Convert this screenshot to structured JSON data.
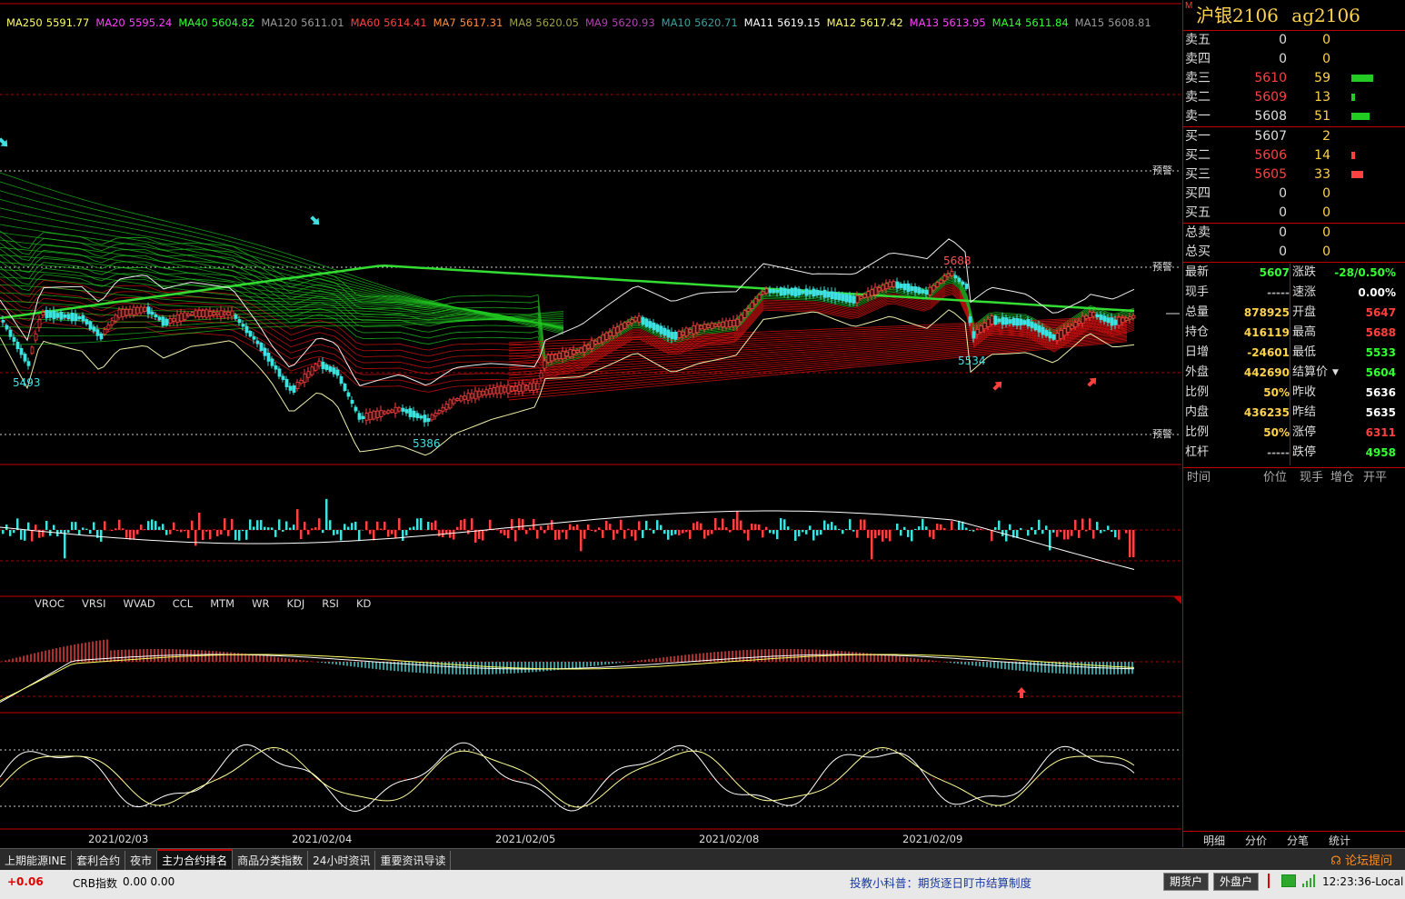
{
  "ma_legend": [
    {
      "label": "MA250",
      "value": "5591.77",
      "color": "#ffff66"
    },
    {
      "label": "MA20",
      "value": "5595.24",
      "color": "#ff40ff"
    },
    {
      "label": "MA40",
      "value": "5604.82",
      "color": "#33ff33"
    },
    {
      "label": "MA120",
      "value": "5611.01",
      "color": "#9a9a9a"
    },
    {
      "label": "MA60",
      "value": "5614.41",
      "color": "#ff4040"
    },
    {
      "label": "MA7",
      "value": "5617.31",
      "color": "#ff8c40"
    },
    {
      "label": "MA8",
      "value": "5620.05",
      "color": "#a0a040"
    },
    {
      "label": "MA9",
      "value": "5620.93",
      "color": "#b040b0"
    },
    {
      "label": "MA10",
      "value": "5620.71",
      "color": "#3aa0a0"
    },
    {
      "label": "MA11",
      "value": "5619.15",
      "color": "#ffffff"
    },
    {
      "label": "MA12",
      "value": "5617.42",
      "color": "#ffff66"
    },
    {
      "label": "MA13",
      "value": "5613.95",
      "color": "#ff40ff"
    },
    {
      "label": "MA14",
      "value": "5611.84",
      "color": "#33ff33"
    },
    {
      "label": "MA15",
      "value": "5608.81",
      "color": "#9a9a9a"
    }
  ],
  "chart": {
    "alert_label": "预警",
    "price_marks": [
      {
        "text": "5493",
        "color": "#40e0e0"
      },
      {
        "text": "5386",
        "color": "#40e0e0"
      },
      {
        "text": "5688",
        "color": "#ff5050"
      },
      {
        "text": "5534",
        "color": "#40e0e0"
      }
    ],
    "dates": [
      "2021/02/03",
      "2021/02/04",
      "2021/02/05",
      "2021/02/08",
      "2021/02/09"
    ],
    "indicator_tabs": [
      "VROC",
      "VRSI",
      "WVAD",
      "CCL",
      "MTM",
      "WR",
      "KDJ",
      "RSI",
      "KD"
    ]
  },
  "side": {
    "title_flag": "M",
    "title_name": "沪银2106",
    "title_code": "ag2106",
    "sell": [
      {
        "label": "卖五",
        "price": "0",
        "vol": "0",
        "pcolor": "#ddd"
      },
      {
        "label": "卖四",
        "price": "0",
        "vol": "0",
        "pcolor": "#ddd"
      },
      {
        "label": "卖三",
        "price": "5610",
        "vol": "59",
        "pcolor": "#ff4040",
        "bar": 24,
        "bcolor": "#22cc22"
      },
      {
        "label": "卖二",
        "price": "5609",
        "vol": "13",
        "pcolor": "#ff4040",
        "bar": 4,
        "bcolor": "#22cc22"
      },
      {
        "label": "卖一",
        "price": "5608",
        "vol": "51",
        "pcolor": "#ddd",
        "bar": 20,
        "bcolor": "#22cc22"
      }
    ],
    "buy": [
      {
        "label": "买一",
        "price": "5607",
        "vol": "2",
        "pcolor": "#ddd"
      },
      {
        "label": "买二",
        "price": "5606",
        "vol": "14",
        "pcolor": "#ff4040",
        "bar": 4,
        "bcolor": "#ff4040"
      },
      {
        "label": "买三",
        "price": "5605",
        "vol": "33",
        "pcolor": "#ff4040",
        "bar": 13,
        "bcolor": "#ff4040"
      },
      {
        "label": "买四",
        "price": "0",
        "vol": "0",
        "pcolor": "#ddd"
      },
      {
        "label": "买五",
        "price": "0",
        "vol": "0",
        "pcolor": "#ddd"
      }
    ],
    "totals": [
      {
        "label": "总卖",
        "price": "0",
        "vol": "0"
      },
      {
        "label": "总买",
        "price": "0",
        "vol": "0"
      }
    ],
    "quotes": [
      {
        "l1": "最新",
        "v1": "5607",
        "c1": "#33ff33",
        "l2": "涨跌",
        "v2": "-28/0.50%",
        "c2": "#33ff33"
      },
      {
        "l1": "现手",
        "v1": "-----",
        "c1": "#aaa",
        "l2": "速涨",
        "v2": "0.00%",
        "c2": "#fff"
      },
      {
        "l1": "总量",
        "v1": "878925",
        "c1": "#ffd24d",
        "l2": "开盘",
        "v2": "5647",
        "c2": "#ff4040"
      },
      {
        "l1": "持仓",
        "v1": "416119",
        "c1": "#ffd24d",
        "l2": "最高",
        "v2": "5688",
        "c2": "#ff4040"
      },
      {
        "l1": "日增",
        "v1": "-24601",
        "c1": "#ffd24d",
        "l2": "最低",
        "v2": "5533",
        "c2": "#33ff33"
      },
      {
        "l1": "外盘",
        "v1": "442690",
        "c1": "#ffd24d",
        "l2": "结算价",
        "v2": "5604",
        "c2": "#33ff33"
      },
      {
        "l1": "比例",
        "v1": "50%",
        "c1": "#ffd24d",
        "l2": "昨收",
        "v2": "5636",
        "c2": "#fff"
      },
      {
        "l1": "内盘",
        "v1": "436235",
        "c1": "#ffd24d",
        "l2": "昨结",
        "v2": "5635",
        "c2": "#fff"
      },
      {
        "l1": "比例",
        "v1": "50%",
        "c1": "#ffd24d",
        "l2": "涨停",
        "v2": "6311",
        "c2": "#ff4040"
      },
      {
        "l1": "杠杆",
        "v1": "-----",
        "c1": "#aaa",
        "l2": "跌停",
        "v2": "4958",
        "c2": "#33ff33"
      }
    ],
    "tick_header": [
      "时间",
      "价位",
      "现手",
      "增仓",
      "开平"
    ],
    "bottom_tabs": [
      "明细",
      "分价",
      "分笔",
      "统计"
    ]
  },
  "tabbar": {
    "tabs": [
      "上期能源INE",
      "套利合约",
      "夜市",
      "主力合约排名",
      "商品分类指数",
      "24小时资讯",
      "重要资讯导读"
    ],
    "active_index": 3,
    "forum": "论坛提问"
  },
  "status": {
    "change": "+0.06",
    "crb_label": "CRB指数",
    "crb_value": "0.00  0.00",
    "notice": "投教小科普：期货逐日盯市结算制度",
    "btn_futures": "期货户",
    "btn_forex": "外盘户",
    "clock": "12:23:36-Local"
  }
}
